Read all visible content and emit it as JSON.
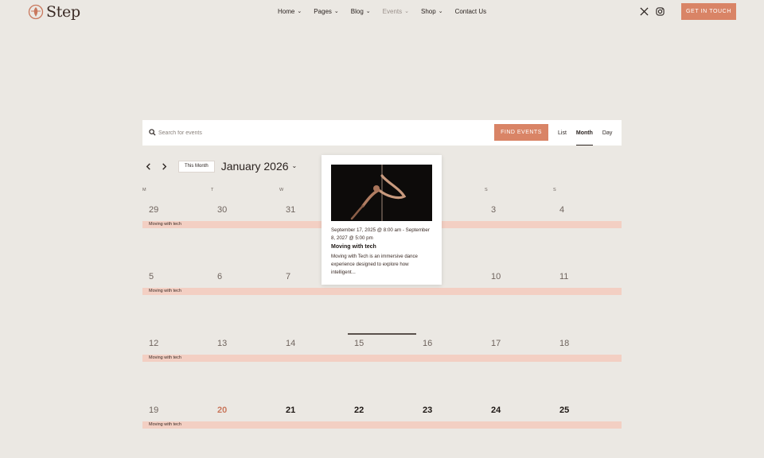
{
  "header": {
    "logo_text": "Step",
    "nav": [
      {
        "label": "Home",
        "has_dropdown": true
      },
      {
        "label": "Pages",
        "has_dropdown": true
      },
      {
        "label": "Blog",
        "has_dropdown": true
      },
      {
        "label": "Events",
        "has_dropdown": true,
        "active": true
      },
      {
        "label": "Shop",
        "has_dropdown": true
      },
      {
        "label": "Contact Us",
        "has_dropdown": false
      }
    ],
    "social_icons": [
      "x-icon",
      "instagram-icon"
    ],
    "cta_label": "GET IN TOUCH"
  },
  "search": {
    "placeholder": "Search for events",
    "value": "",
    "button_label": "FIND EVENTS",
    "views": [
      "List",
      "Month",
      "Day"
    ],
    "active_view": "Month"
  },
  "month_nav": {
    "this_month_label": "This Month",
    "title": "January 2026"
  },
  "calendar": {
    "weekday_headers": [
      "M",
      "T",
      "W",
      "",
      "",
      "S",
      "S"
    ],
    "weeks": [
      {
        "days": [
          "29",
          "30",
          "31",
          "",
          "",
          "3",
          "4"
        ],
        "event": "Moving with tech"
      },
      {
        "days": [
          "5",
          "6",
          "7",
          "",
          "",
          "10",
          "11"
        ],
        "event": "Moving with tech"
      },
      {
        "days": [
          "12",
          "13",
          "14",
          "15",
          "16",
          "17",
          "18"
        ],
        "event": "Moving with tech"
      },
      {
        "days": [
          "19",
          "20",
          "21",
          "22",
          "23",
          "24",
          "25"
        ],
        "event": "Moving with tech"
      }
    ],
    "today": "20"
  },
  "tooltip": {
    "date_range": "September 17, 2025 @ 8:00 am - September 8, 2027 @ 5:00 pm",
    "title": "Moving with tech",
    "description": "Moving with Tech is an immersive dance experience designed to explore how intelligent..."
  },
  "colors": {
    "accent": "#d98466",
    "event_bar": "#f3cfc3",
    "background": "#ebe8e3",
    "today": "#c9785d"
  }
}
